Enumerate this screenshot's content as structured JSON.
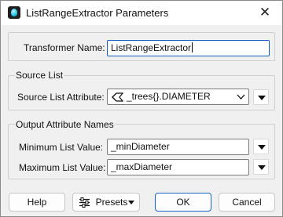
{
  "window": {
    "title": "ListRangeExtractor Parameters",
    "close_glyph": "✕",
    "icon": "fme-workbench-icon"
  },
  "transformer": {
    "label": "Transformer Name:",
    "value": "ListRangeExtractor"
  },
  "source_list": {
    "group_title": "Source List",
    "label": "Source List Attribute:",
    "value": "_trees{}.DIAMETER",
    "attribute_icon": "list-attribute-icon"
  },
  "output": {
    "group_title": "Output Attribute Names",
    "min_label": "Minimum List Value:",
    "min_value": "_minDiameter",
    "max_label": "Maximum List Value:",
    "max_value": "_maxDiameter"
  },
  "buttons": {
    "help": "Help",
    "presets": "Presets",
    "ok": "OK",
    "cancel": "Cancel"
  },
  "colors": {
    "focus_border": "#0f5fbf",
    "window_bg": "#f0f0f0"
  }
}
